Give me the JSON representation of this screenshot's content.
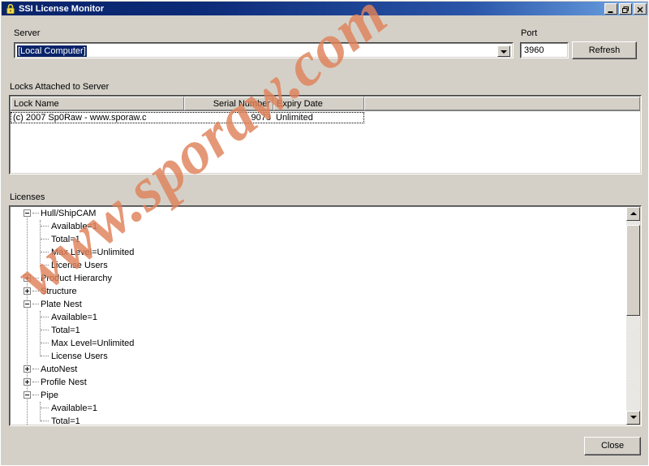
{
  "window": {
    "title": "SSI License Monitor",
    "icon": "padlock-icon",
    "minimize_label": "Minimize",
    "restore_label": "Restore",
    "close_label": "Close",
    "accent_title_color": "#0a246a",
    "face_color": "#d4d0c8"
  },
  "server": {
    "label": "Server",
    "value": "[Local Computer]",
    "placeholder": "[Local Computer]"
  },
  "port": {
    "label": "Port",
    "value": "3960",
    "placeholder": "3960"
  },
  "refresh": {
    "label": "Refresh"
  },
  "locks": {
    "label": "Locks Attached to Server",
    "columns": [
      "Lock Name",
      "Serial Number",
      "Expiry Date",
      ""
    ],
    "rows": [
      {
        "lock_name": "(c) 2007 Sp0Raw - www.sporaw.c",
        "serial_number": "9073",
        "expiry_date": "Unlimited",
        "extra": ""
      }
    ]
  },
  "licenses": {
    "label": "Licenses",
    "tree": [
      {
        "label": "Hull/ShipCAM",
        "level": 0,
        "state": "expanded"
      },
      {
        "label": "Available=1",
        "level": 1,
        "state": "leaf"
      },
      {
        "label": "Total=1",
        "level": 1,
        "state": "leaf"
      },
      {
        "label": "Max Level=Unlimited",
        "level": 1,
        "state": "leaf"
      },
      {
        "label": "License Users",
        "level": 1,
        "state": "leaf"
      },
      {
        "label": "Product Hierarchy",
        "level": 0,
        "state": "collapsed"
      },
      {
        "label": "Structure",
        "level": 0,
        "state": "collapsed"
      },
      {
        "label": "Plate Nest",
        "level": 0,
        "state": "expanded"
      },
      {
        "label": "Available=1",
        "level": 1,
        "state": "leaf"
      },
      {
        "label": "Total=1",
        "level": 1,
        "state": "leaf"
      },
      {
        "label": "Max Level=Unlimited",
        "level": 1,
        "state": "leaf"
      },
      {
        "label": "License Users",
        "level": 1,
        "state": "leaf"
      },
      {
        "label": "AutoNest",
        "level": 0,
        "state": "collapsed"
      },
      {
        "label": "Profile Nest",
        "level": 0,
        "state": "collapsed"
      },
      {
        "label": "Pipe",
        "level": 0,
        "state": "expanded"
      },
      {
        "label": "Available=1",
        "level": 1,
        "state": "leaf"
      },
      {
        "label": "Total=1",
        "level": 1,
        "state": "leaf"
      }
    ],
    "scrollbar": {
      "up_label": "Scroll up",
      "down_label": "Scroll down",
      "thumb_top_pct": 2,
      "thumb_height_pct": 48
    }
  },
  "footer": {
    "close_label": "Close"
  },
  "watermark": {
    "text": "www.sporaw.com",
    "color": "#e0825a"
  }
}
